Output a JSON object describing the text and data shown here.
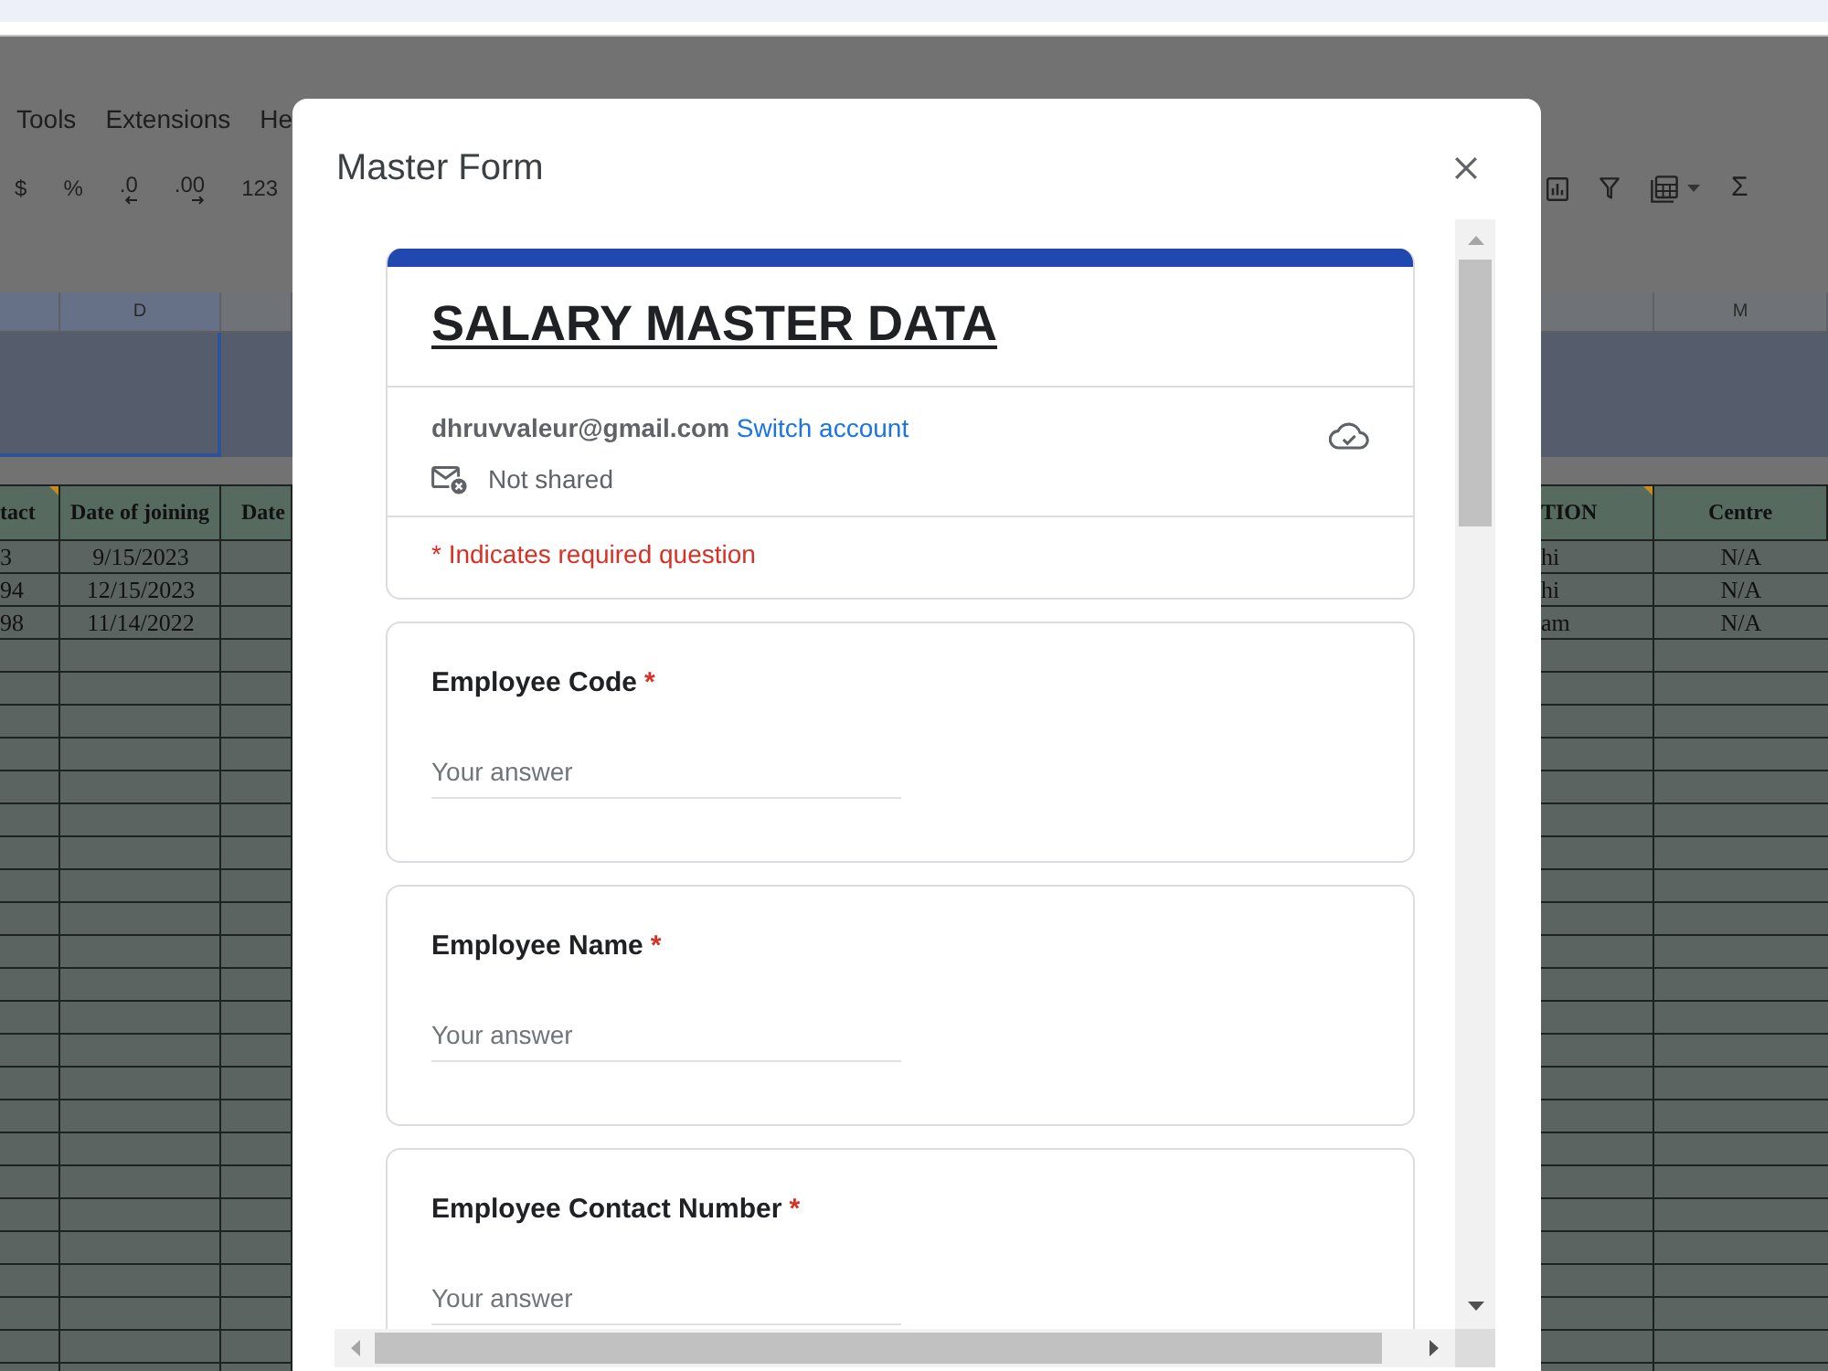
{
  "spreadsheet": {
    "menu": [
      {
        "label": "Tools"
      },
      {
        "label": "Extensions"
      },
      {
        "label": "He"
      }
    ],
    "toolbar_left": [
      {
        "kind": "text",
        "label": "$"
      },
      {
        "kind": "text",
        "label": "%"
      },
      {
        "kind": "decimal_decrease",
        "label": ".0"
      },
      {
        "kind": "decimal_increase",
        "label": ".00"
      },
      {
        "kind": "text",
        "label": "123"
      }
    ],
    "toolbar_right": [
      {
        "kind": "chart"
      },
      {
        "kind": "filter"
      },
      {
        "kind": "table_menu"
      },
      {
        "kind": "text",
        "label": "Σ"
      }
    ],
    "left_pane": {
      "columns": [
        {
          "header": "tact",
          "note": true,
          "selected": true
        },
        {
          "letter": "D",
          "header": "Date of joining",
          "note": false,
          "selected": true
        },
        {
          "header": "Date",
          "note": false,
          "selected": false
        }
      ],
      "rows": [
        [
          "3",
          "9/15/2023"
        ],
        [
          "94",
          "12/15/2023"
        ],
        [
          "98",
          "11/14/2022"
        ]
      ]
    },
    "right_pane": {
      "columns": [
        {
          "header": "TION",
          "note": true,
          "selected": false
        },
        {
          "letter": "M",
          "header": "Centre",
          "note": false,
          "selected": false
        }
      ],
      "rows": [
        [
          "hi",
          "N/A"
        ],
        [
          "hi",
          "N/A"
        ],
        [
          "am",
          "N/A"
        ]
      ]
    }
  },
  "dialog": {
    "title": "Master Form",
    "form": {
      "title": "SALARY MASTER DATA",
      "account": {
        "email": "dhruvvaleur@gmail.com",
        "switch_link": "Switch account",
        "sharing": "Not shared"
      },
      "required_note": "* Indicates required question",
      "questions": [
        {
          "label": "Employee Code",
          "required_mark": "*",
          "placeholder": "Your answer"
        },
        {
          "label": "Employee Name",
          "required_mark": "*",
          "placeholder": "Your answer"
        },
        {
          "label": "Employee Contact Number",
          "required_mark": "*",
          "placeholder": "Your answer"
        }
      ]
    }
  }
}
